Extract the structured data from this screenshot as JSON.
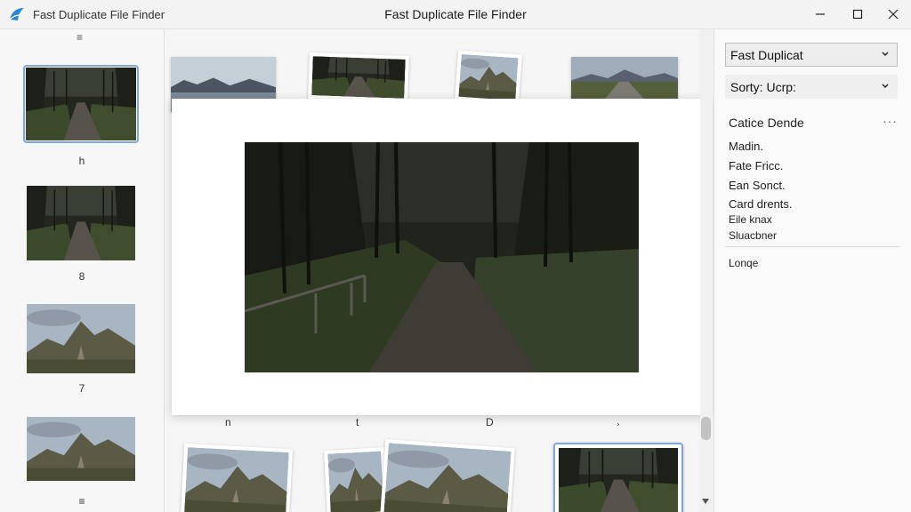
{
  "window": {
    "app_name": "Fast Duplicate File Finder",
    "title": "Fast Duplicate File Finder"
  },
  "left_pane": {
    "menu_glyph": "≡",
    "items": [
      {
        "label": "h",
        "selected": true
      },
      {
        "label": "8",
        "selected": false
      },
      {
        "label": "7",
        "selected": false
      },
      {
        "label": "≡",
        "selected": false
      }
    ]
  },
  "grid": {
    "row_labels": [
      "n",
      "t",
      "D",
      "¸"
    ]
  },
  "right_pane": {
    "dropdown_primary": "Fast Duplicat",
    "dropdown_sort": "Sorty: Ucrp:",
    "heading": "Catice Dende",
    "more_glyph": "···",
    "items": [
      "Madin.",
      "Fate Fricc.",
      "Ean Sonct.",
      "Card drents.",
      "Eile knax",
      "Sluacbner"
    ],
    "footer_item": "Lonqe"
  },
  "colors": {
    "accent": "#7fa8d6",
    "app_icon": "#2f86d6",
    "forest_dark": "#2a2e26",
    "sky": "#a9b8c6"
  },
  "icons": {
    "app": "app-logo-icon",
    "minimize": "minimize-icon",
    "maximize": "maximize-icon",
    "close": "close-icon",
    "dropdown": "chevron-down-icon"
  }
}
